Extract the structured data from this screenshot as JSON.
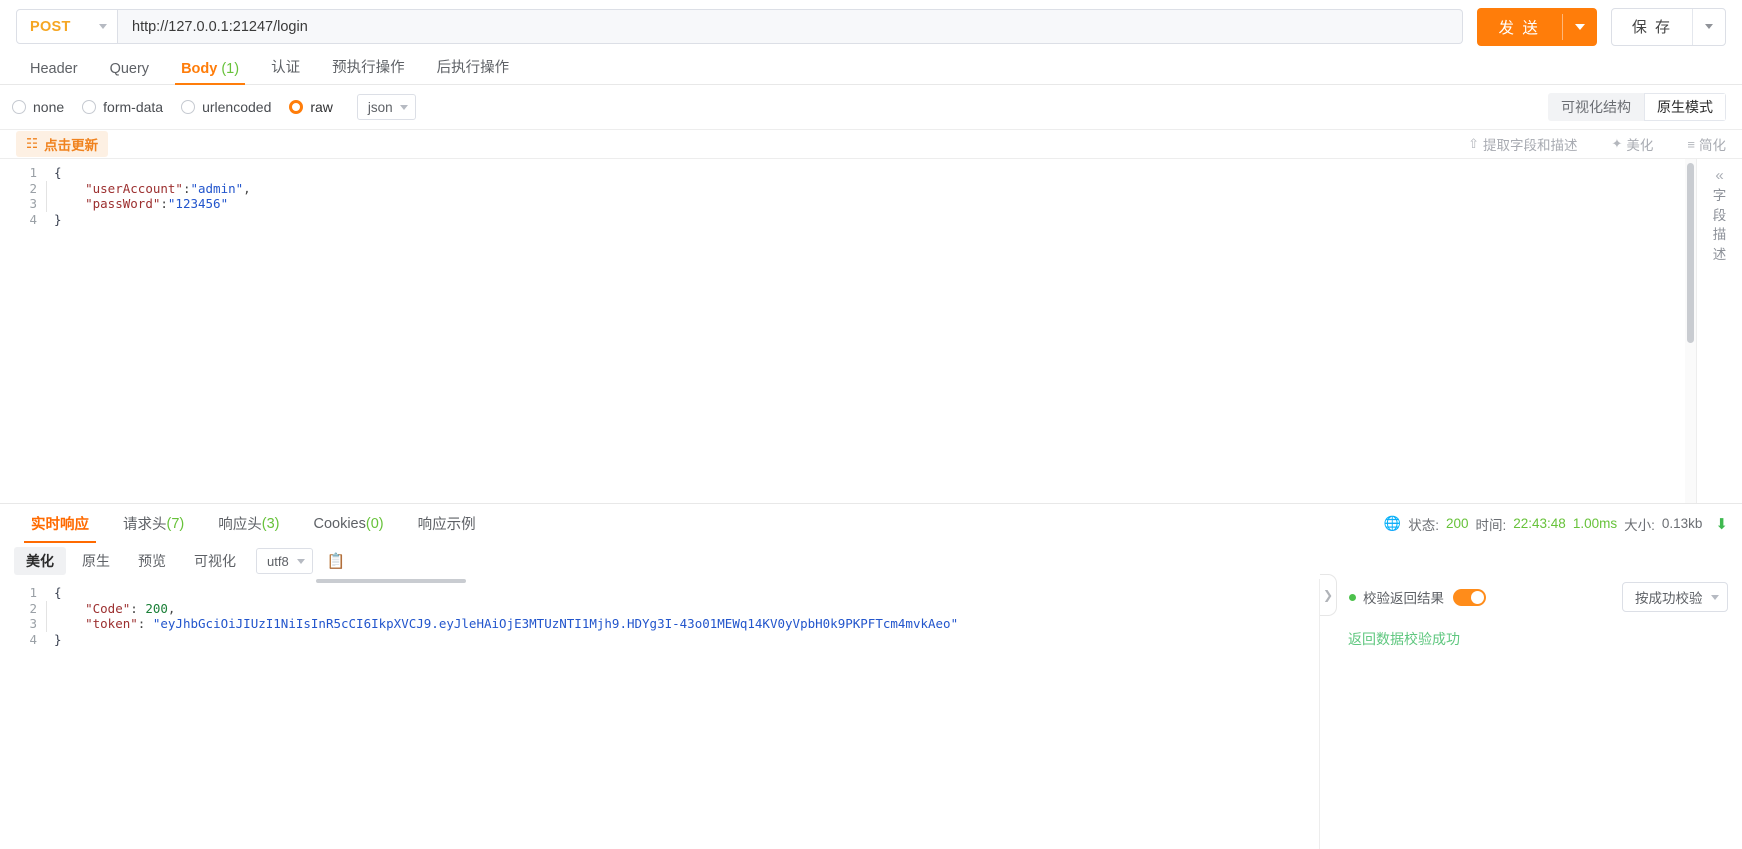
{
  "urlbar": {
    "method": "POST",
    "url": "http://127.0.0.1:21247/login",
    "send_label": "发 送",
    "save_label": "保 存"
  },
  "request_tabs": [
    {
      "label": "Header",
      "count": "",
      "active": false
    },
    {
      "label": "Query",
      "count": "",
      "active": false
    },
    {
      "label": "Body",
      "count": "(1)",
      "active": true
    },
    {
      "label": "认证",
      "count": "",
      "active": false
    },
    {
      "label": "预执行操作",
      "count": "",
      "active": false
    },
    {
      "label": "后执行操作",
      "count": "",
      "active": false
    }
  ],
  "body_type": {
    "options": [
      {
        "label": "none",
        "selected": false
      },
      {
        "label": "form-data",
        "selected": false
      },
      {
        "label": "urlencoded",
        "selected": false
      },
      {
        "label": "raw",
        "selected": true
      }
    ],
    "format": "json",
    "view_modes": [
      {
        "label": "可视化结构",
        "active": false
      },
      {
        "label": "原生模式",
        "active": true
      }
    ]
  },
  "editor_toolbar": {
    "update_chip": "点击更新",
    "update_icon": "form-icon",
    "tools": [
      {
        "label": "提取字段和描述",
        "icon": "upload-icon"
      },
      {
        "label": "美化",
        "icon": "wand-icon"
      },
      {
        "label": "简化",
        "icon": "list-icon"
      }
    ]
  },
  "request_body": {
    "lines": [
      {
        "no": "1",
        "indent": false,
        "tokens": [
          {
            "t": "{",
            "c": "tk-brace"
          }
        ]
      },
      {
        "no": "2",
        "indent": true,
        "tokens": [
          {
            "t": "\"userAccount\"",
            "c": "tk-key"
          },
          {
            "t": ":",
            "c": "tk-punc"
          },
          {
            "t": "\"admin\"",
            "c": "tk-str"
          },
          {
            "t": ",",
            "c": "tk-punc"
          }
        ]
      },
      {
        "no": "3",
        "indent": true,
        "tokens": [
          {
            "t": "\"passWord\"",
            "c": "tk-key"
          },
          {
            "t": ":",
            "c": "tk-punc"
          },
          {
            "t": "\"123456\"",
            "c": "tk-str"
          }
        ]
      },
      {
        "no": "4",
        "indent": false,
        "tokens": [
          {
            "t": "}",
            "c": "tk-brace"
          }
        ]
      }
    ]
  },
  "side_panel": {
    "collapse_icon": "«",
    "chars": [
      "字",
      "段",
      "描",
      "述"
    ]
  },
  "response_tabs": [
    {
      "label": "实时响应",
      "count": "",
      "active": true
    },
    {
      "label": "请求头",
      "count": "(7)",
      "active": false
    },
    {
      "label": "响应头",
      "count": "(3)",
      "active": false
    },
    {
      "label": "Cookies",
      "count": "(0)",
      "active": false
    },
    {
      "label": "响应示例",
      "count": "",
      "active": false
    }
  ],
  "status": {
    "globe_icon": "globe-icon",
    "state_label": "状态:",
    "state_value": "200",
    "time_label": "时间:",
    "time_value": "22:43:48",
    "duration": "1.00ms",
    "size_label": "大小:",
    "size_value": "0.13kb",
    "download_icon": "download-icon"
  },
  "response_toolbar": {
    "buttons": [
      {
        "label": "美化",
        "active": true
      },
      {
        "label": "原生",
        "active": false
      },
      {
        "label": "预览",
        "active": false
      },
      {
        "label": "可视化",
        "active": false
      }
    ],
    "encoding": "utf8",
    "copy_icon": "copy-icon"
  },
  "response_body": {
    "lines": [
      {
        "no": "1",
        "indent": false,
        "tokens": [
          {
            "t": "{",
            "c": "tk-brace"
          }
        ]
      },
      {
        "no": "2",
        "indent": true,
        "tokens": [
          {
            "t": "\"Code\"",
            "c": "tk-key"
          },
          {
            "t": ": ",
            "c": "tk-punc"
          },
          {
            "t": "200",
            "c": "tk-num"
          },
          {
            "t": ",",
            "c": "tk-punc"
          }
        ]
      },
      {
        "no": "3",
        "indent": true,
        "tokens": [
          {
            "t": "\"token\"",
            "c": "tk-key"
          },
          {
            "t": ": ",
            "c": "tk-punc"
          },
          {
            "t": "\"eyJhbGciOiJIUzI1NiIsInR5cCI6IkpXVCJ9.eyJleHAiOjE3MTUzNTI1Mjh9.HDYg3I-43o01MEWq14KV0yVpbH0k9PKPFTcm4mvkAeo\"",
            "c": "tk-str"
          }
        ]
      },
      {
        "no": "4",
        "indent": false,
        "tokens": [
          {
            "t": "}",
            "c": "tk-brace"
          }
        ]
      }
    ]
  },
  "validation": {
    "chevron_icon": "chevron-right-icon",
    "label": "校验返回结果",
    "toggle_on": true,
    "mode": "按成功校验",
    "result_message": "返回数据校验成功",
    "accent_color": "#ff8c1a",
    "success_color": "#5fc77f"
  }
}
